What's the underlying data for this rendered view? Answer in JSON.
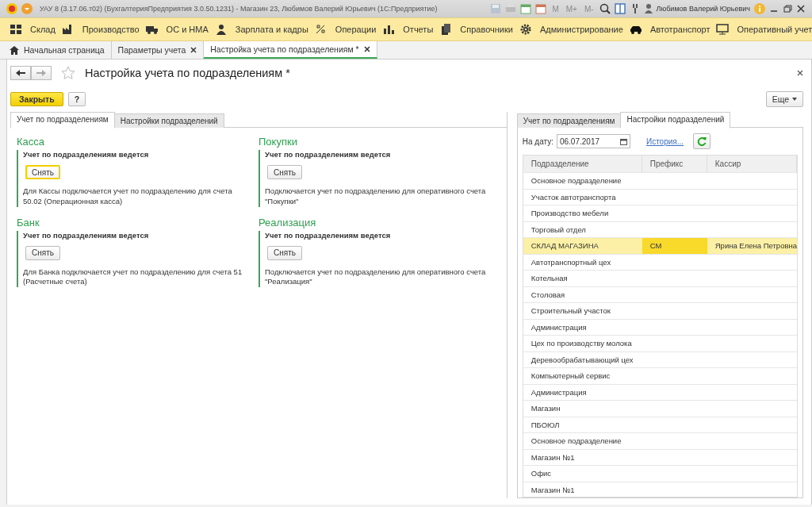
{
  "window": {
    "title": "УАУ 8 (3.17.06.т02) (БухгалтерияПредприятия 3.0.50.1231) - Магазин 23, Любимов Валерий Юрьевич  (1С:Предприятие)",
    "memory_buttons": [
      "M",
      "M+",
      "M-"
    ],
    "user": "Любимов Валерий Юрьевич"
  },
  "sections": [
    {
      "label": "Склад"
    },
    {
      "label": "Производство"
    },
    {
      "label": "ОС и НМА"
    },
    {
      "label": "Зарплата и кадры"
    },
    {
      "label": "Операции"
    },
    {
      "label": "Отчеты"
    },
    {
      "label": "Справочники"
    },
    {
      "label": "Администрирование"
    },
    {
      "label": "Автотранспорт"
    },
    {
      "label": "Оперативный учет"
    }
  ],
  "open_tabs": [
    {
      "label": "Начальная страница",
      "selected": false,
      "closable": false
    },
    {
      "label": "Параметры учета",
      "selected": false,
      "closable": true
    },
    {
      "label": "Настройка учета по подразделениям *",
      "selected": true,
      "closable": true
    }
  ],
  "form": {
    "title": "Настройка учета по подразделениям *",
    "close_button": "Закрыть",
    "help_button": "?",
    "more_button": "Еще",
    "tabs": [
      {
        "label": "Учет по подразделениям",
        "selected": true
      },
      {
        "label": "Настройки подразделений",
        "selected": false
      }
    ],
    "groups": [
      {
        "title": "Касса",
        "status": "Учет по подразделениям  ведется",
        "button": "Снять",
        "focused": true,
        "note": "Для Кассы подключается учет по подразделению для счета 50.02 (Операционная касса)"
      },
      {
        "title": "Покупки",
        "status": "Учет по подразделениям  ведется",
        "button": "Снять",
        "focused": false,
        "note": "Подключается учет по подразделению для оперативного счета \"Покупки\""
      },
      {
        "title": "Банк",
        "status": "Учет по подразделениям  ведется",
        "button": "Снять",
        "focused": false,
        "note": "Для Банка подключается учет по подразделению для счета 51 (Расчетные счета)"
      },
      {
        "title": "Реализация",
        "status": "Учет по подразделениям  ведется",
        "button": "Снять",
        "focused": false,
        "note": "Подключается учет по подразделению для оперативного счета \"Реализация\""
      }
    ]
  },
  "side_panel": {
    "tabs": [
      {
        "label": "Учет по подразделениям",
        "selected": false
      },
      {
        "label": "Настройки подразделений",
        "selected": true
      }
    ],
    "date_label": "На дату:",
    "date": "06.07.2017",
    "history_link": "История...",
    "columns": [
      "Подразделение",
      "Префикс",
      "Кассир"
    ],
    "rows": [
      {
        "name": "Основное подразделение",
        "selected": false
      },
      {
        "name": "Участок автотранспорта",
        "selected": false
      },
      {
        "name": "Производство мебели",
        "selected": false
      },
      {
        "name": "Торговый отдел",
        "selected": false
      },
      {
        "name": "СКЛАД МАГАЗИНА",
        "prefix": "СМ",
        "cashier": "Ярина Елена Петровна",
        "selected": true
      },
      {
        "name": "Автотранспортный цех",
        "selected": false
      },
      {
        "name": "Котельная",
        "selected": false
      },
      {
        "name": "Столовая",
        "selected": false
      },
      {
        "name": "Строительный участок",
        "selected": false
      },
      {
        "name": "Администрация",
        "selected": false
      },
      {
        "name": "Цех по производству молока",
        "selected": false
      },
      {
        "name": "Деревообрабатывающий цех",
        "selected": false
      },
      {
        "name": "Компьютерный сервис",
        "selected": false
      },
      {
        "name": "Администрация",
        "selected": false
      },
      {
        "name": "Магазин",
        "selected": false
      },
      {
        "name": "ПБОЮЛ",
        "selected": false
      },
      {
        "name": "Основное подразделение",
        "selected": false
      },
      {
        "name": "Магазин №1",
        "selected": false
      },
      {
        "name": "Офис",
        "selected": false
      },
      {
        "name": "Магазин №1",
        "selected": false
      }
    ]
  }
}
